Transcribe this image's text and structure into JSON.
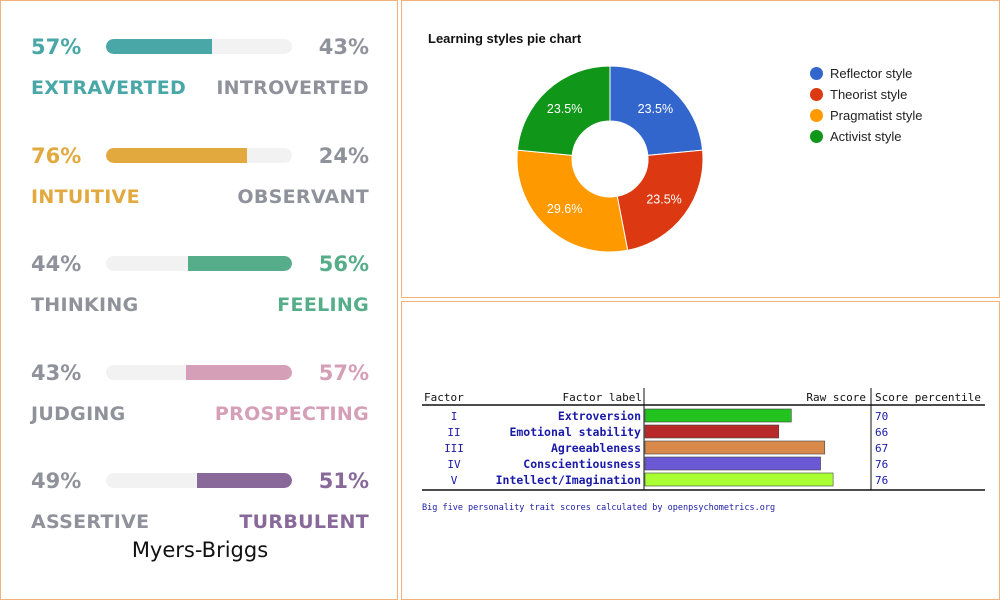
{
  "myers_briggs": {
    "caption": "Myers-Briggs",
    "traits": [
      {
        "left_pct": "57%",
        "right_pct": "43%",
        "left_label": "EXTRAVERTED",
        "right_label": "INTROVERTED",
        "fill_side": "left",
        "fill_fraction": 0.57,
        "color": "#4aa7a7",
        "left_color": "#4aa7a7",
        "right_color": "#8f929a"
      },
      {
        "left_pct": "76%",
        "right_pct": "24%",
        "left_label": "INTUITIVE",
        "right_label": "OBSERVANT",
        "fill_side": "left",
        "fill_fraction": 0.76,
        "color": "#e2a93f",
        "left_color": "#e2a93f",
        "right_color": "#8f929a"
      },
      {
        "left_pct": "44%",
        "right_pct": "56%",
        "left_label": "THINKING",
        "right_label": "FEELING",
        "fill_side": "right",
        "fill_fraction": 0.56,
        "color": "#56ad8a",
        "left_color": "#8f929a",
        "right_color": "#56ad8a"
      },
      {
        "left_pct": "43%",
        "right_pct": "57%",
        "left_label": "JUDGING",
        "right_label": "PROSPECTING",
        "fill_side": "right",
        "fill_fraction": 0.57,
        "color": "#d59fb7",
        "left_color": "#8f929a",
        "right_color": "#d59fb7"
      },
      {
        "left_pct": "49%",
        "right_pct": "51%",
        "left_label": "ASSERTIVE",
        "right_label": "TURBULENT",
        "fill_side": "right",
        "fill_fraction": 0.51,
        "color": "#88699a",
        "left_color": "#8f929a",
        "right_color": "#88699a"
      }
    ]
  },
  "chart_data": [
    {
      "type": "pie",
      "title": "Learning styles pie chart",
      "donut": true,
      "legend_position": "right",
      "slices": [
        {
          "name": "Reflector style",
          "value": 23.5,
          "label": "23.5%",
          "color": "#3366cc"
        },
        {
          "name": "Theorist style",
          "value": 23.5,
          "label": "23.5%",
          "color": "#dc3912"
        },
        {
          "name": "Pragmatist style",
          "value": 29.6,
          "label": "29.6%",
          "color": "#ff9900"
        },
        {
          "name": "Activist style",
          "value": 23.5,
          "label": "23.5%",
          "color": "#109618"
        }
      ]
    },
    {
      "type": "bar",
      "orientation": "horizontal",
      "columns": [
        "Factor",
        "Factor label",
        "Raw score",
        "Score percentile"
      ],
      "rows": [
        {
          "factor": "I",
          "label": "Extroversion",
          "value": 70,
          "percentile": "70",
          "color": "#22c21f"
        },
        {
          "factor": "II",
          "label": "Emotional stability",
          "value": 64,
          "percentile": "66",
          "color": "#b82a2a"
        },
        {
          "factor": "III",
          "label": "Agreeableness",
          "value": 86,
          "percentile": "67",
          "color": "#d9894a"
        },
        {
          "factor": "IV",
          "label": "Conscientiousness",
          "value": 84,
          "percentile": "76",
          "color": "#6a58d4"
        },
        {
          "factor": "V",
          "label": "Intellect/Imagination",
          "value": 90,
          "percentile": "76",
          "color": "#aaff33"
        }
      ],
      "xlim": [
        0,
        100
      ],
      "caption": "Big five personality trait scores calculated by openpsychometrics.org"
    }
  ]
}
